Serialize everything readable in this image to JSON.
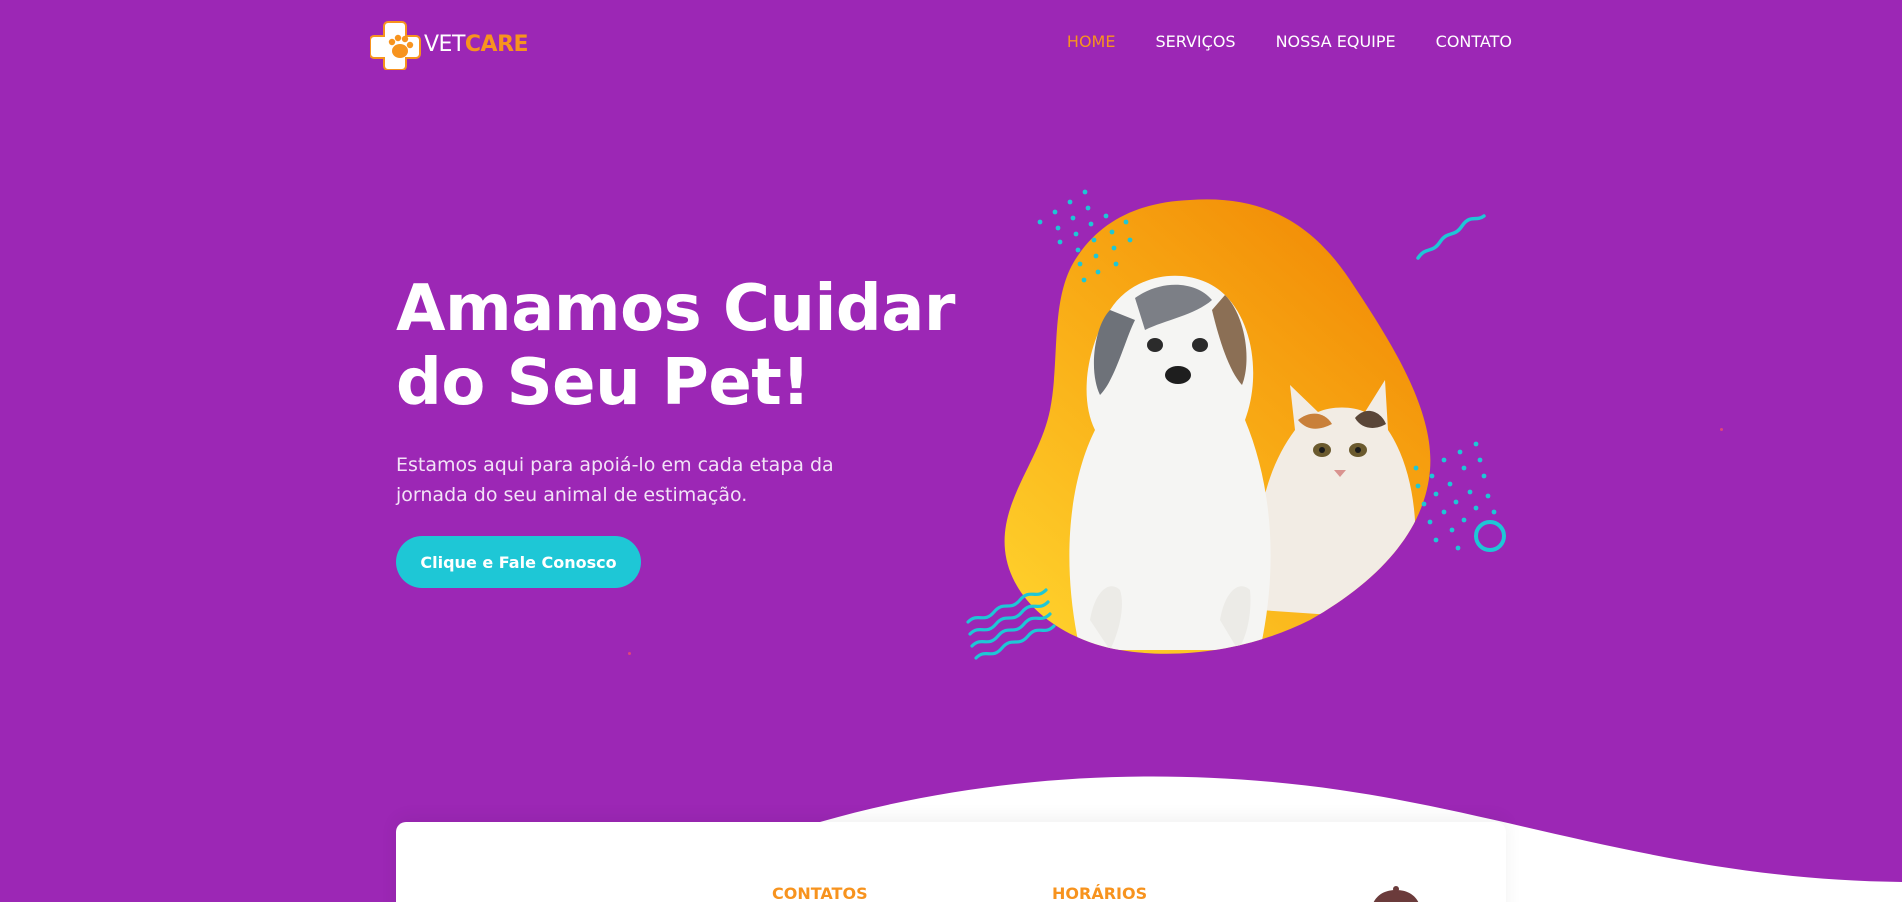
{
  "brand": {
    "vet": "VET",
    "care": "CARE"
  },
  "nav": {
    "items": [
      {
        "label": "HOME",
        "active": true
      },
      {
        "label": "SERVIÇOS",
        "active": false
      },
      {
        "label": "NOSSA EQUIPE",
        "active": false
      },
      {
        "label": "CONTATO",
        "active": false
      }
    ]
  },
  "hero": {
    "title_line1": "Amamos Cuidar",
    "title_line2": "do Seu Pet!",
    "subtitle": "Estamos aqui para apoiá-lo em cada etapa da jornada do seu animal de estimação.",
    "cta_label": "Clique e Fale Conosco"
  },
  "info": {
    "contacts_heading": "CONTATOS",
    "hours_heading": "HORÁRIOS"
  },
  "colors": {
    "background": "#9c27b5",
    "accent": "#f7931e",
    "teal": "#1ec7d6",
    "white": "#ffffff"
  },
  "icons": [
    "vetcare-paw-cross-logo",
    "pet-illustration"
  ]
}
